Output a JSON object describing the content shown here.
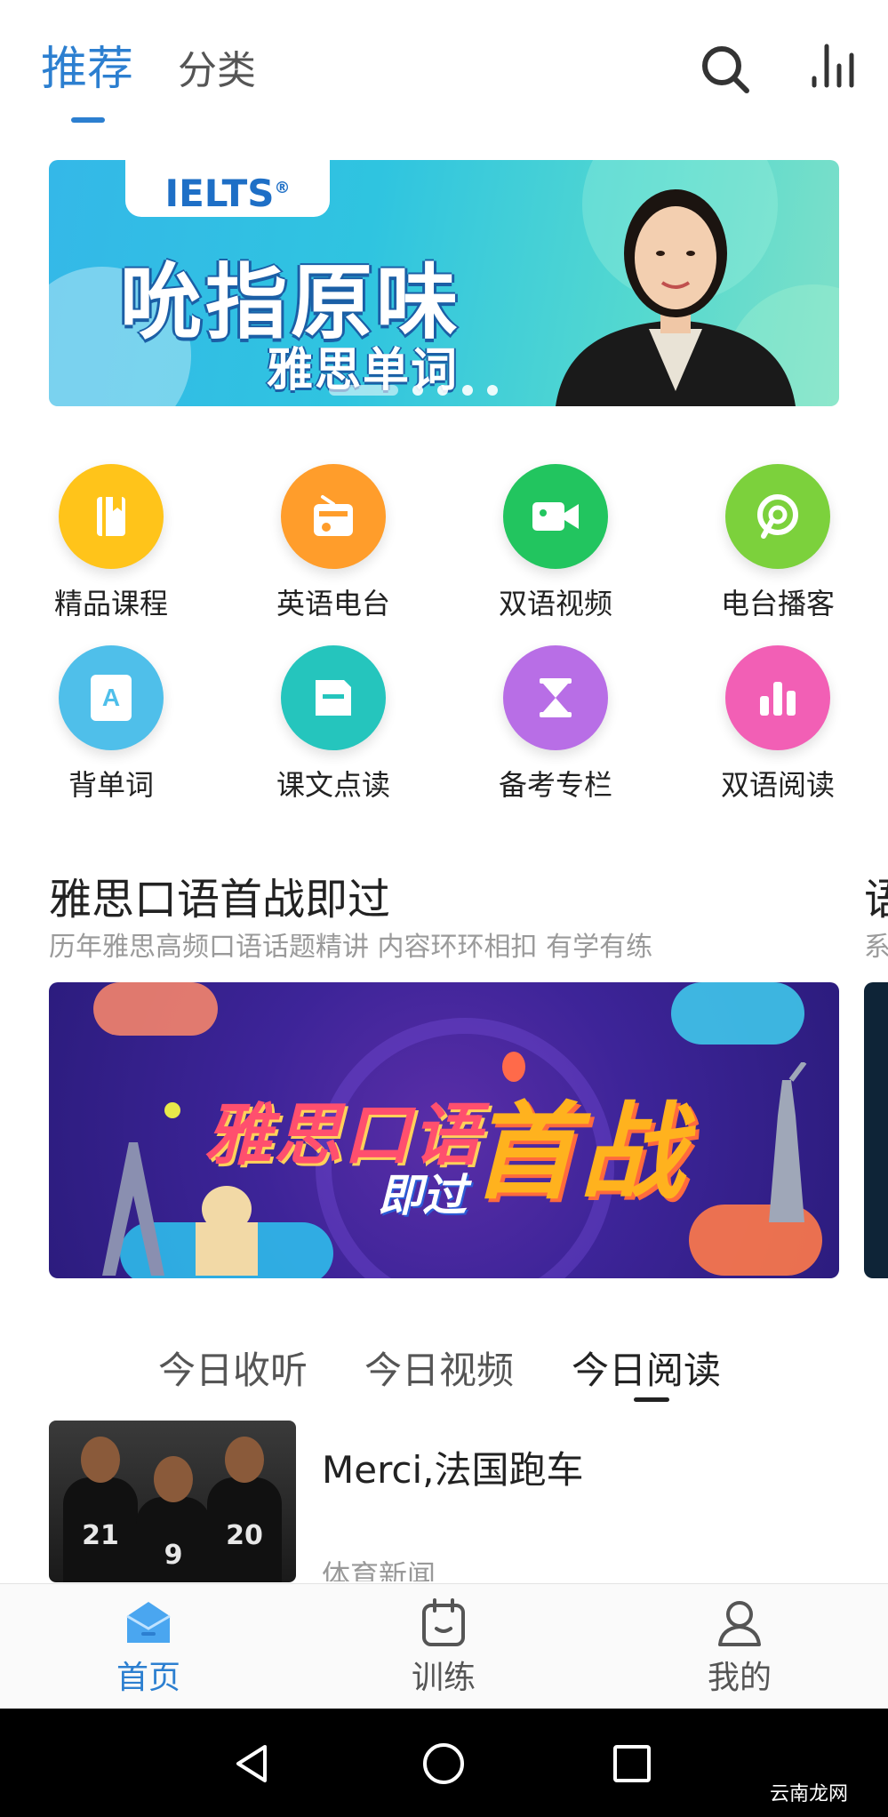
{
  "header": {
    "tabs": [
      {
        "label": "推荐",
        "active": true
      },
      {
        "label": "分类",
        "active": false
      }
    ],
    "icons": [
      "search-icon",
      "stats-icon"
    ]
  },
  "hero": {
    "badge": "IELTS",
    "badge_mark": "®",
    "title": "吮指原味",
    "subtitle": "雅思单词",
    "slides_total": 5,
    "slide_active": 1
  },
  "grid": {
    "items": [
      {
        "label": "精品课程",
        "icon": "book-icon",
        "color": "#ffc41a"
      },
      {
        "label": "英语电台",
        "icon": "radio-icon",
        "color": "#ff9d2b"
      },
      {
        "label": "双语视频",
        "icon": "video-camera-icon",
        "color": "#22c55f"
      },
      {
        "label": "电台播客",
        "icon": "podcast-icon",
        "color": "#7cd13c"
      },
      {
        "label": "背单词",
        "icon": "vocab-card-icon",
        "color": "#4fbfea"
      },
      {
        "label": "课文点读",
        "icon": "document-icon",
        "color": "#25c5bd"
      },
      {
        "label": "备考专栏",
        "icon": "hourglass-icon",
        "color": "#b86ee6"
      },
      {
        "label": "双语阅读",
        "icon": "bar-chart-icon",
        "color": "#f25fb5"
      }
    ],
    "icon_letter": "A"
  },
  "section": {
    "title": "雅思口语首战即过",
    "subtitle": "历年雅思高频口语话题精讲 内容环环相扣 有学有练",
    "next_title_peek": "语",
    "next_sub_peek": "系",
    "promo_text_1": "雅思口语",
    "promo_text_2": "首战",
    "promo_text_3": "即过"
  },
  "daily_tabs": [
    {
      "label": "今日收听",
      "active": false
    },
    {
      "label": "今日视频",
      "active": false
    },
    {
      "label": "今日阅读",
      "active": true
    }
  ],
  "article": {
    "title": "Merci,法国跑车",
    "tag": "体育新闻",
    "jersey_numbers": [
      "21",
      "9",
      "20"
    ]
  },
  "bottom_nav": [
    {
      "label": "首页",
      "icon": "home-icon",
      "active": true
    },
    {
      "label": "训练",
      "icon": "calendar-icon",
      "active": false
    },
    {
      "label": "我的",
      "icon": "profile-icon",
      "active": false
    }
  ],
  "system_bar": {
    "buttons": [
      "back-icon",
      "home-circle-icon",
      "recents-icon"
    ],
    "watermark": "云南龙网"
  },
  "colors": {
    "accent": "#2c7fd0",
    "hero_start": "#34b8e8",
    "promo_bg": "#3d2498"
  }
}
